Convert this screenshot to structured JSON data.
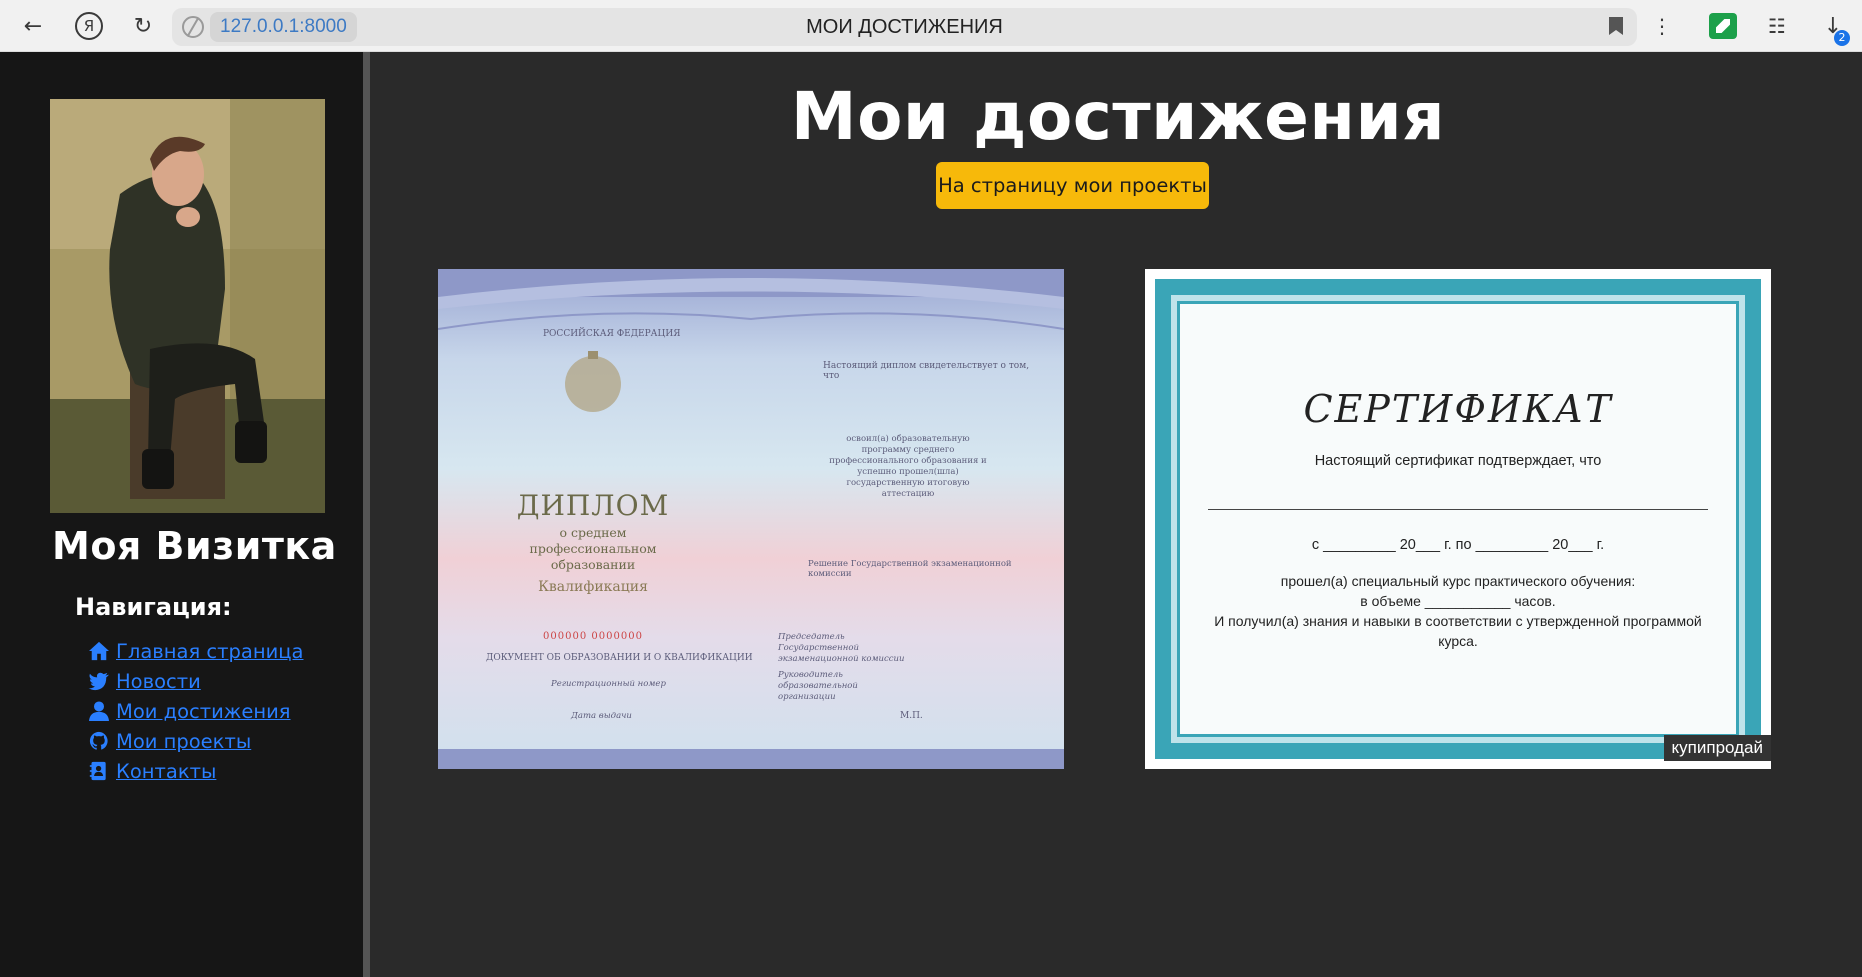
{
  "browser": {
    "url": "127.0.0.1:8000",
    "tab_title": "МОИ ДОСТИЖЕНИЯ",
    "downloads_badge": "2"
  },
  "sidebar": {
    "site_title": "Моя Визитка",
    "nav_heading": "Навигация:",
    "nav": [
      {
        "label": " Главная страница",
        "icon": "home-icon"
      },
      {
        "label": " Новости",
        "icon": "twitter-icon"
      },
      {
        "label": " Мои достижения",
        "icon": "user-icon"
      },
      {
        "label": " Мои проекты",
        "icon": "github-icon"
      },
      {
        "label": " Контакты",
        "icon": "address-book-icon"
      }
    ]
  },
  "main": {
    "title": "Мои достижения",
    "button_label": "На страницу мои проекты"
  },
  "diploma": {
    "country": "РОССИЙСКАЯ ФЕДЕРАЦИЯ",
    "heading": "ДИПЛОМ",
    "subheading": "о среднем профессиональном образовании",
    "qualification": "Квалификация",
    "number": "000000 0000000",
    "doc_line": "ДОКУМЕНТ ОБ ОБРАЗОВАНИИ И О КВАЛИФИКАЦИИ",
    "reg_number": "Регистрационный номер",
    "issue_date": "Дата выдачи",
    "right_top": "Настоящий диплом свидетельствует о том, что",
    "right_mid": "освоил(а) образовательную программу среднего профессионального образования и успешно прошел(шла) государственную итоговую аттестацию",
    "commission": "Решение Государственной экзаменационной комиссии",
    "chairman": "Председатель Государственной экзаменационной комиссии",
    "head": "Руководитель образовательной организации",
    "mp": "М.П."
  },
  "certificate": {
    "heading": "СЕРТИФИКАТ",
    "line1": "Настоящий сертификат подтверждает, что",
    "dates": "с _________ 20___ г. по _________ 20___ г.",
    "line2": "прошел(а) специальный курс практического обучения:",
    "line3": "в объеме ___________ часов.",
    "line4": "И получил(а) знания и навыки в соответствии с утвержденной программой",
    "line5": "курса.",
    "watermark": "купипродай"
  }
}
